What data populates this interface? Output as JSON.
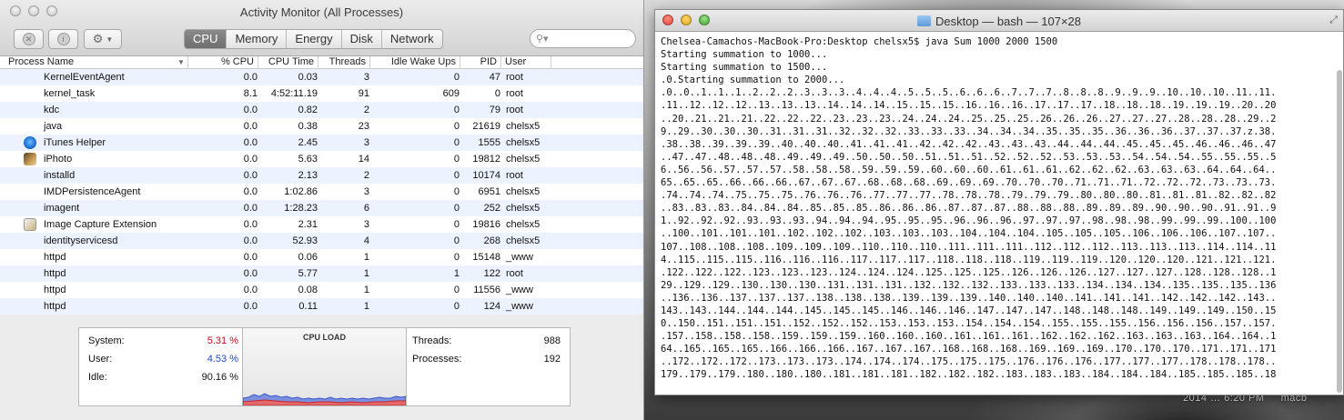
{
  "desktop": {
    "clock_text": "2014 … 6:20 PM",
    "extra_text": "macb"
  },
  "activity_monitor": {
    "title": "Activity Monitor (All Processes)",
    "tabs": [
      "CPU",
      "Memory",
      "Energy",
      "Disk",
      "Network"
    ],
    "active_tab": "CPU",
    "search_placeholder": "",
    "columns": [
      "Process Name",
      "% CPU",
      "CPU Time",
      "Threads",
      "Idle Wake Ups",
      "PID",
      "User"
    ],
    "rows": [
      {
        "name": "KernelEventAgent",
        "cpu": "0.0",
        "time": "0.03",
        "threads": "3",
        "wake": "0",
        "pid": "47",
        "user": "root",
        "icon": ""
      },
      {
        "name": "kernel_task",
        "cpu": "8.1",
        "time": "4:52:11.19",
        "threads": "91",
        "wake": "609",
        "pid": "0",
        "user": "root",
        "icon": ""
      },
      {
        "name": "kdc",
        "cpu": "0.0",
        "time": "0.82",
        "threads": "2",
        "wake": "0",
        "pid": "79",
        "user": "root",
        "icon": ""
      },
      {
        "name": "java",
        "cpu": "0.0",
        "time": "0.38",
        "threads": "23",
        "wake": "0",
        "pid": "21619",
        "user": "chelsx5",
        "icon": ""
      },
      {
        "name": "iTunes Helper",
        "cpu": "0.0",
        "time": "2.45",
        "threads": "3",
        "wake": "0",
        "pid": "1555",
        "user": "chelsx5",
        "icon": "itunes"
      },
      {
        "name": "iPhoto",
        "cpu": "0.0",
        "time": "5.63",
        "threads": "14",
        "wake": "0",
        "pid": "19812",
        "user": "chelsx5",
        "icon": "iphoto"
      },
      {
        "name": "installd",
        "cpu": "0.0",
        "time": "2.13",
        "threads": "2",
        "wake": "0",
        "pid": "10174",
        "user": "root",
        "icon": ""
      },
      {
        "name": "IMDPersistenceAgent",
        "cpu": "0.0",
        "time": "1:02.86",
        "threads": "3",
        "wake": "0",
        "pid": "6951",
        "user": "chelsx5",
        "icon": ""
      },
      {
        "name": "imagent",
        "cpu": "0.0",
        "time": "1:28.23",
        "threads": "6",
        "wake": "0",
        "pid": "252",
        "user": "chelsx5",
        "icon": ""
      },
      {
        "name": "Image Capture Extension",
        "cpu": "0.0",
        "time": "2.31",
        "threads": "3",
        "wake": "0",
        "pid": "19816",
        "user": "chelsx5",
        "icon": "imagecap"
      },
      {
        "name": "identityservicesd",
        "cpu": "0.0",
        "time": "52.93",
        "threads": "4",
        "wake": "0",
        "pid": "268",
        "user": "chelsx5",
        "icon": ""
      },
      {
        "name": "httpd",
        "cpu": "0.0",
        "time": "0.06",
        "threads": "1",
        "wake": "0",
        "pid": "15148",
        "user": "_www",
        "icon": ""
      },
      {
        "name": "httpd",
        "cpu": "0.0",
        "time": "5.77",
        "threads": "1",
        "wake": "1",
        "pid": "122",
        "user": "root",
        "icon": ""
      },
      {
        "name": "httpd",
        "cpu": "0.0",
        "time": "0.08",
        "threads": "1",
        "wake": "0",
        "pid": "11556",
        "user": "_www",
        "icon": ""
      },
      {
        "name": "httpd",
        "cpu": "0.0",
        "time": "0.11",
        "threads": "1",
        "wake": "0",
        "pid": "124",
        "user": "_www",
        "icon": ""
      }
    ],
    "footer": {
      "system_label": "System:",
      "system_value": "5.31 %",
      "user_label": "User:",
      "user_value": "4.53 %",
      "idle_label": "Idle:",
      "idle_value": "90.16 %",
      "cpu_load_title": "CPU LOAD",
      "threads_label": "Threads:",
      "threads_value": "988",
      "processes_label": "Processes:",
      "processes_value": "192",
      "system_color": "#d0021b",
      "user_color": "#1f47c9"
    }
  },
  "terminal": {
    "title": "Desktop — bash — 107×28",
    "lines": [
      "Chelsea-Camachos-MacBook-Pro:Desktop chelsx5$ java Sum 1000 2000 1500",
      "Starting summation to 1000...",
      "Starting summation to 1500...",
      ".0.Starting summation to 2000...",
      ".0..0..1..1..1..2..2..2..3..3..3..4..4..4..5..5..5..6..6..6..7..7..7..8..8..8..9..9..9..10..10..10..11..11.",
      ".11..12..12..12..13..13..13..14..14..14..15..15..15..16..16..16..17..17..17..18..18..18..19..19..19..20..20",
      "..20..21..21..21..22..22..22..23..23..23..24..24..24..25..25..25..26..26..26..27..27..27..28..28..28..29..2",
      "9..29..30..30..30..31..31..31..32..32..32..33..33..33..34..34..34..35..35..35..36..36..36..37..37..37.z.38.",
      ".38..38..39..39..39..40..40..40..41..41..41..42..42..42..43..43..43..44..44..44..45..45..45..46..46..46..47",
      "..47..47..48..48..48..49..49..49..50..50..50..51..51..51..52..52..52..53..53..53..54..54..54..55..55..55..5",
      "6..56..56..57..57..57..58..58..58..59..59..59..60..60..60..61..61..61..62..62..62..63..63..63..64..64..64..",
      "65..65..65..66..66..66..67..67..67..68..68..68..69..69..69..70..70..70..71..71..71..72..72..72..73..73..73.",
      ".74..74..74..75..75..75..76..76..76..77..77..77..78..78..78..79..79..79..80..80..80..81..81..81..82..82..82",
      "..83..83..83..84..84..84..85..85..85..86..86..86..87..87..87..88..88..88..89..89..89..90..90..90..91..91..9",
      "1..92..92..92..93..93..93..94..94..94..95..95..95..96..96..96..97..97..97..98..98..98..99..99..99..100..100",
      "..100..101..101..101..102..102..102..103..103..103..104..104..104..105..105..105..106..106..106..107..107..",
      "107..108..108..108..109..109..109..110..110..110..111..111..111..112..112..112..113..113..113..114..114..11",
      "4..115..115..115..116..116..116..117..117..117..118..118..118..119..119..119..120..120..120..121..121..121.",
      ".122..122..122..123..123..123..124..124..124..125..125..125..126..126..126..127..127..127..128..128..128..1",
      "29..129..129..130..130..130..131..131..131..132..132..132..133..133..133..134..134..134..135..135..135..136",
      "..136..136..137..137..137..138..138..138..139..139..139..140..140..140..141..141..141..142..142..142..143..",
      "143..143..144..144..144..145..145..145..146..146..146..147..147..147..148..148..148..149..149..149..150..15",
      "0..150..151..151..151..152..152..152..153..153..153..154..154..154..155..155..155..156..156..156..157..157.",
      ".157..158..158..158..159..159..159..160..160..160..161..161..161..162..162..162..163..163..163..164..164..1",
      "64..165..165..165..166..166..166..167..167..167..168..168..168..169..169..169..170..170..170..171..171..171",
      "..172..172..172..173..173..173..174..174..174..175..175..175..176..176..176..177..177..177..178..178..178..",
      "179..179..179..180..180..180..181..181..181..182..182..182..183..183..183..184..184..184..185..185..185..18"
    ]
  }
}
